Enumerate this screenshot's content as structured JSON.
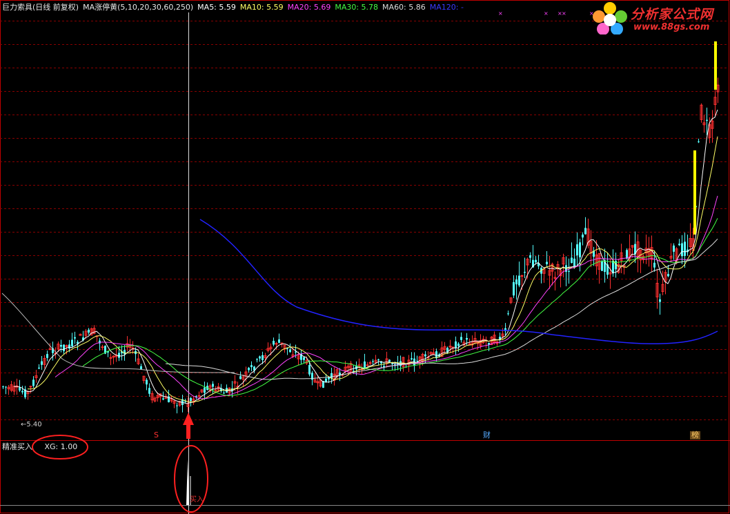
{
  "header": {
    "title": "巨力索具(日线 前复权)",
    "indicator": "MA涨停黄(5,10,20,30,60,250)",
    "ma5": "MA5: 5.59",
    "ma10": "MA10: 5.59",
    "ma20": "MA20: 5.69",
    "ma30": "MA30: 5.78",
    "ma60": "MA60: 5.86",
    "ma120": "MA120: -"
  },
  "colors": {
    "ma5": "#ffffff",
    "ma10": "#ffff66",
    "ma20": "#ff44ff",
    "ma30": "#44ff44",
    "ma60": "#dddddd",
    "ma120": "#2222ff",
    "up": "#ff3030",
    "down": "#55ffff",
    "limit_up": "#ffff00",
    "grid": "#8b0000"
  },
  "price_label": "←5.40",
  "event_markers": [
    {
      "label": "S",
      "color": "#ff3030"
    },
    {
      "label": "财",
      "color": "#55aaff"
    },
    {
      "label": "榜",
      "color": "#ffcc66"
    }
  ],
  "sub_panel": {
    "title": "精准买入",
    "xg": "XG: 1.00",
    "signal_text": "买入"
  },
  "logo": {
    "name": "分析家公式网",
    "url": "www.88gs.com"
  }
}
